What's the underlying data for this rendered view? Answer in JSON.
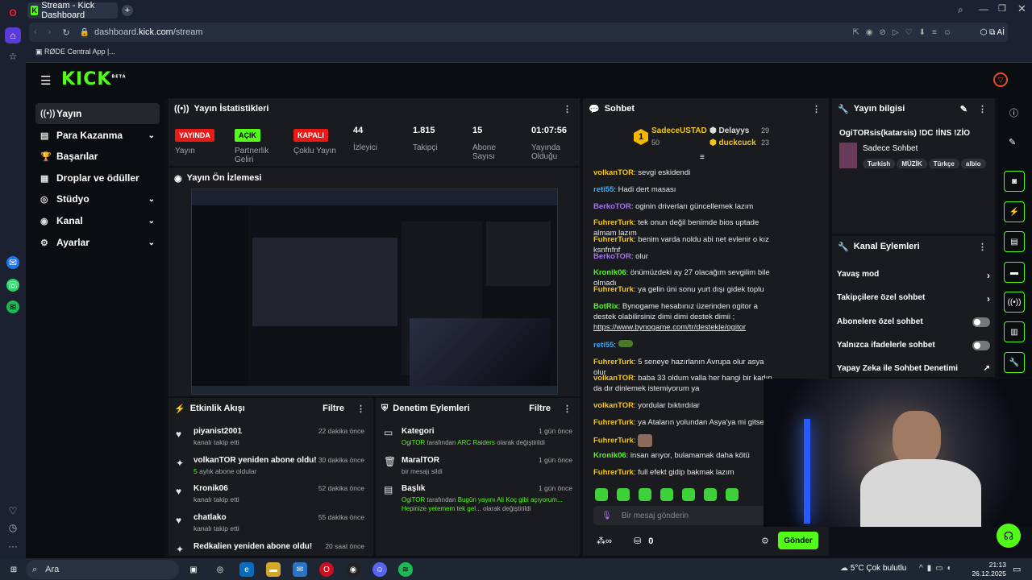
{
  "browser": {
    "tab_title": "Stream - Kick Dashboard",
    "url_domain": "dashboard.",
    "url_host": "kick.com",
    "url_path": "/stream",
    "bookmark": "RØDE Central App |..."
  },
  "nav": {
    "items": [
      {
        "label": "Yayın"
      },
      {
        "label": "Para Kazanma"
      },
      {
        "label": "Başarılar"
      },
      {
        "label": "Droplar ve ödüller"
      },
      {
        "label": "Stüdyo"
      },
      {
        "label": "Kanal"
      },
      {
        "label": "Ayarlar"
      }
    ]
  },
  "stats": {
    "title": "Yayın İstatistikleri",
    "items": [
      {
        "badge": "YAYINDA",
        "label": "Yayın",
        "color": "#e91916"
      },
      {
        "badge": "AÇIK",
        "label": "Partnerlik Geliri",
        "color": "#53fc18"
      },
      {
        "badge": "KAPALI",
        "label": "Çoklu Yayın",
        "color": "#e91916"
      },
      {
        "value": "44",
        "label": "İzleyici"
      },
      {
        "value": "1.815",
        "label": "Takipçi"
      },
      {
        "value": "15",
        "label": "Abone Sayısı"
      },
      {
        "value": "01:07:56",
        "label": "Yayında Olduğu"
      }
    ]
  },
  "preview": {
    "title": "Yayın Ön İzlemesi"
  },
  "activity": {
    "title": "Etkinlik Akışı",
    "filter": "Filtre",
    "items": [
      {
        "t1": "piyanist2001",
        "t2": "kanalı takip etti",
        "time": "22 dakika önce"
      },
      {
        "t1": "volkanTOR yeniden abone oldu!",
        "t2a": "5",
        "t2b": " aylık abone oldular",
        "time": "30 dakika önce"
      },
      {
        "t1": "Kronik06",
        "t2": "kanalı takip etti",
        "time": "52 dakika önce"
      },
      {
        "t1": "chatlako",
        "t2": "kanalı takip etti",
        "time": "55 dakika önce"
      },
      {
        "t1": "Redkalien yeniden abone oldu!",
        "t2": "",
        "time": "20 saat önce"
      }
    ]
  },
  "moderation": {
    "title": "Denetim Eylemleri",
    "filter": "Filtre",
    "items": [
      {
        "t1": "Kategori",
        "by": "OgiTOR",
        "mid": " tarafından ",
        "hl": "ARC Raiders",
        "end": " olarak değiştirildi",
        "time": "1 gün önce"
      },
      {
        "t1": "MaralTOR",
        "plain": "bir mesajı sildi",
        "time": "1 gün önce"
      },
      {
        "t1": "Başlık",
        "by": "OgiTOR",
        "mid": " tarafından ",
        "hl": "Bugün yayını Ali Koç gibi açıyorum... Hepinize yetemem tek gel...",
        "end": " olarak değiştirildi",
        "time": "1 gün önce"
      }
    ]
  },
  "chat": {
    "title": "Sohbet",
    "top_user": "SadeceUSTAD",
    "top_val": "50",
    "leader2": "Delayys",
    "leader2_val": "29",
    "leader3": "duckcuck",
    "leader3_val": "23",
    "lines": [
      {
        "user": "volkanTOR",
        "color": "#f5c518",
        "msg": ": sevgi eskidendi"
      },
      {
        "user": "reti55",
        "color": "#2fb0ff",
        "msg": ": Hadi dert masası"
      },
      {
        "user": "BerkoTOR",
        "color": "#a970ff",
        "msg": ": oginin driverları güncellemek lazım"
      },
      {
        "user": "FuhrerTurk",
        "color": "#f5c518",
        "msg": ": tek onun değil benimde bios uptade almam lazım"
      },
      {
        "user": "FuhrerTurk",
        "color": "#f5c518",
        "msg": ": benim varda noldu abi net evlenir o kız ksnfnfnf"
      },
      {
        "user": "BerkoTOR",
        "color": "#a970ff",
        "msg": ": olur"
      },
      {
        "user": "Kronik06",
        "color": "#53fc18",
        "msg": ": önümüzdeki ay 27 olacağım sevgilim bile olmadı"
      },
      {
        "user": "FuhrerTurk",
        "color": "#f5c518",
        "msg": ": ya gelin üni sonu yurt dışı gidek toplu"
      },
      {
        "user": "BotRix",
        "color": "#53fc18",
        "msg": ": Bynogame hesabınız üzerinden ogitor a destek olabilirsiniz dimi dimi destek dimii ;",
        "link": "https://www.bynogame.com/tr/destekle/ogitor"
      },
      {
        "user": "reti55",
        "color": "#2fb0ff",
        "msg": ":"
      },
      {
        "user": "FuhrerTurk",
        "color": "#f5c518",
        "msg": ": 5 seneye hazırlanın Avrupa olur asya olur"
      },
      {
        "user": "volkanTOR",
        "color": "#f5c518",
        "msg": ": baba 33 oldum valla her hangi bir kadın da dır dinlemek istemiyorum ya"
      },
      {
        "user": "volkanTOR",
        "color": "#f5c518",
        "msg": ": yordular bıktırdılar"
      },
      {
        "user": "FuhrerTurk",
        "color": "#f5c518",
        "msg": ": ya Ataların yolundan Asya'ya mi gitsek"
      },
      {
        "user": "FuhrerTurk",
        "color": "#f5c518",
        "msg": ":"
      },
      {
        "user": "Kronik06",
        "color": "#53fc18",
        "msg": ": insan arıyor, bulamamak daha kötü"
      },
      {
        "user": "FuhrerTurk",
        "color": "#f5c518",
        "msg": ": full efekt gidip bakmak lazım"
      }
    ],
    "placeholder": "Bir mesaj gönderin",
    "points": "0",
    "send": "Gönder"
  },
  "info": {
    "title": "Yayın bilgisi",
    "stream_title": "OgiTORsis(katarsis) !DC !İNS !ZİO",
    "category": "Sadece Sohbet",
    "tags": [
      "Turkish",
      "MÜZİK",
      "Türkçe",
      "albio"
    ]
  },
  "actions": {
    "title": "Kanal Eylemleri",
    "items": [
      {
        "label": "Yavaş mod",
        "type": "chevron"
      },
      {
        "label": "Takipçilere özel sohbet",
        "type": "chevron"
      },
      {
        "label": "Abonelere özel sohbet",
        "type": "toggle"
      },
      {
        "label": "Yalnızca ifadelerle sohbet",
        "type": "toggle"
      },
      {
        "label": "Yapay Zeka ile Sohbet Denetimi",
        "type": "link"
      }
    ]
  },
  "taskbar": {
    "search": "Ara",
    "weather": "5°C  Çok bulutlu",
    "time": "21:13",
    "date": "26.12.2025"
  }
}
